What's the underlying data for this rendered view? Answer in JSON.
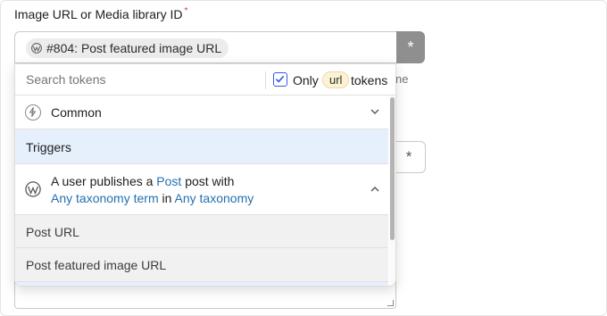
{
  "field": {
    "label": "Image URL or Media library ID",
    "required_mark": "*"
  },
  "selected_token": {
    "icon": "wordpress-icon",
    "id": "#804:",
    "name": "Post featured image URL"
  },
  "insert_token_button": {
    "glyph": "*"
  },
  "background": {
    "partial_text": "ne",
    "second_button_glyph": "*"
  },
  "token_picker": {
    "search": {
      "placeholder": "Search tokens",
      "value": ""
    },
    "filter": {
      "checked": true,
      "only_label": "Only",
      "type_pill": "url",
      "tokens_label": "tokens"
    },
    "categories": [
      {
        "label": "Common",
        "icon": "bolt-icon",
        "expanded": false
      },
      {
        "label": "Triggers",
        "highlighted": true
      }
    ],
    "trigger": {
      "icon": "wordpress-icon",
      "text_1": "A user publishes a ",
      "link_post": "Post",
      "text_2": " post with",
      "link_term": "Any taxonomy term",
      "text_3": " in ",
      "link_taxonomy": "Any taxonomy",
      "expanded": true
    },
    "tokens": [
      {
        "label": "Post URL"
      },
      {
        "label": "Post featured image URL"
      }
    ]
  },
  "colors": {
    "accent": "#3858e9",
    "link": "#2271b1",
    "highlight_row": "#e6f0fc",
    "pill_bg": "#fbf3d3"
  }
}
